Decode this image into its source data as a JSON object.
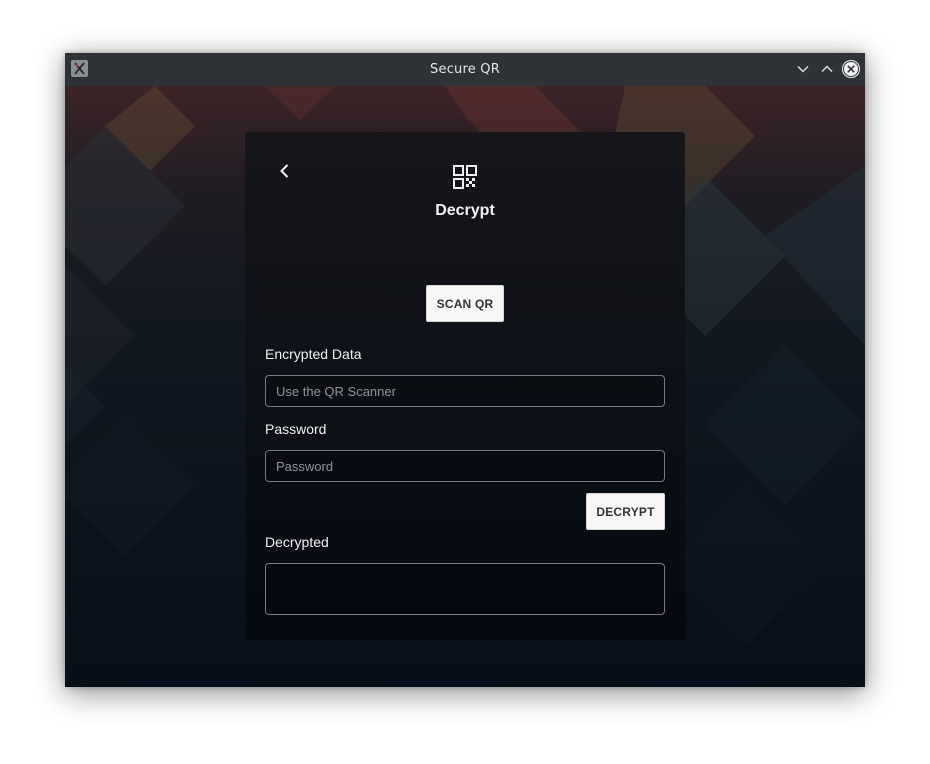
{
  "window": {
    "title": "Secure QR"
  },
  "icons": {
    "app": "x-app-icon",
    "minimize": "chevron-down-icon",
    "maximize": "chevron-up-icon",
    "close": "close-icon",
    "back": "chevron-left-icon",
    "header": "qr-code-icon"
  },
  "page": {
    "title": "Decrypt",
    "scan_button": "SCAN QR",
    "encrypted": {
      "label": "Encrypted Data",
      "value": "",
      "placeholder": "Use the QR Scanner"
    },
    "password": {
      "label": "Password",
      "value": "",
      "placeholder": "Password"
    },
    "decrypt_button": "DECRYPT",
    "decrypted": {
      "label": "Decrypted",
      "value": ""
    }
  },
  "colors": {
    "titlebar": "#2f3338",
    "card": "#0c1017",
    "button_bg": "#f7f7f7",
    "button_text": "#333333",
    "input_border": "#747b84"
  }
}
